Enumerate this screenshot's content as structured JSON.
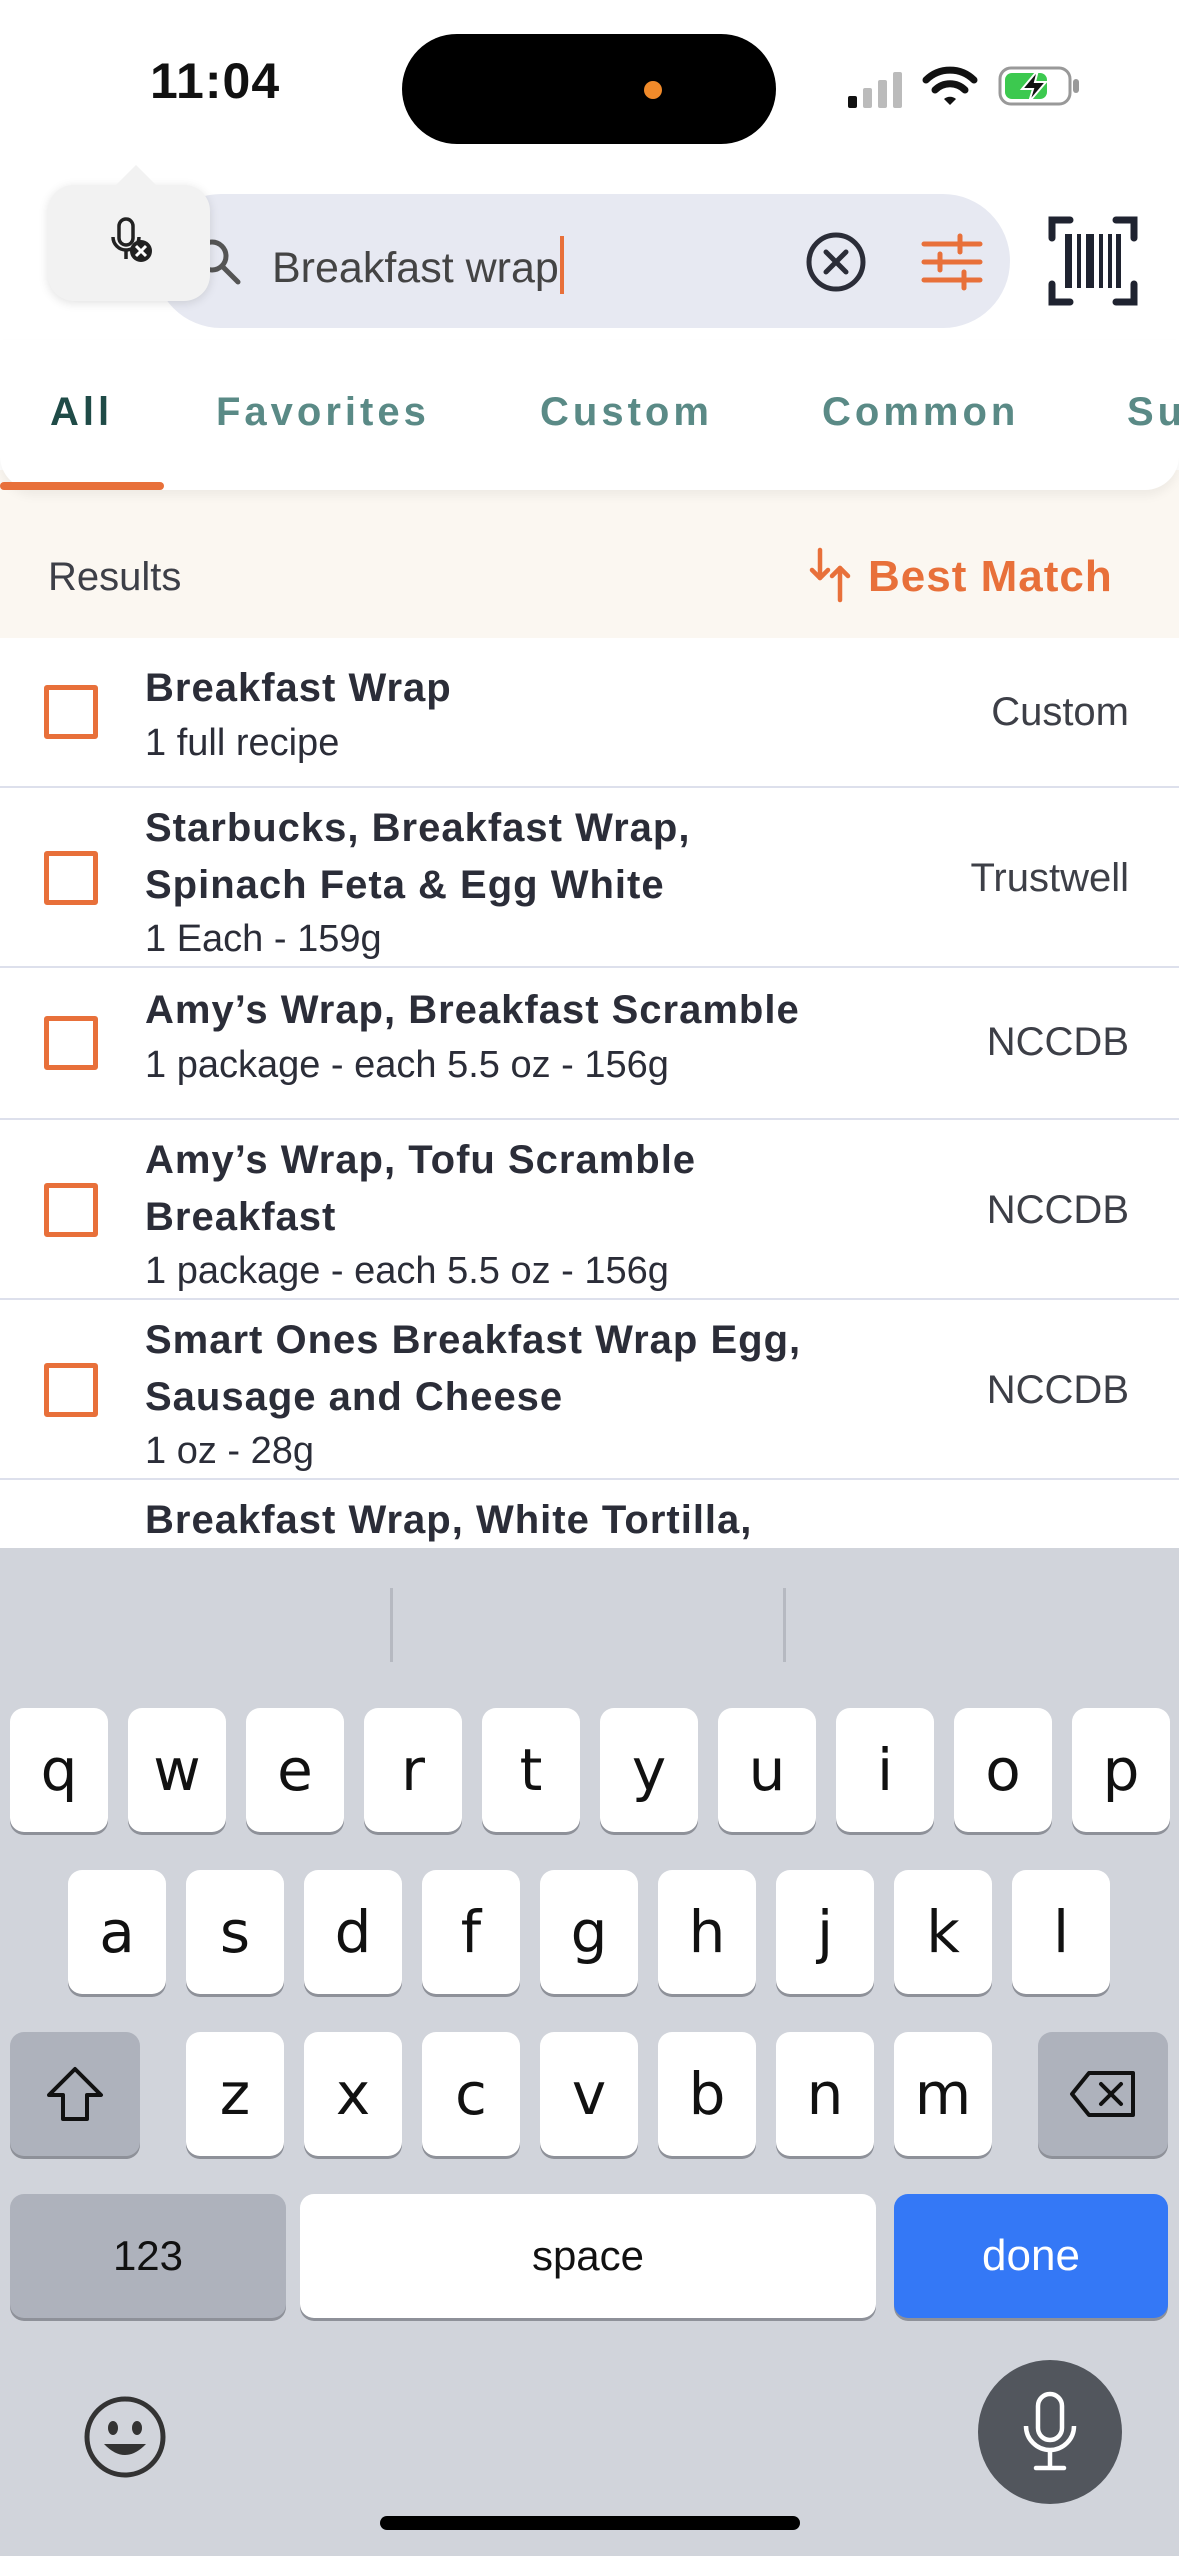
{
  "status_bar": {
    "time": "11:04"
  },
  "search": {
    "query": "Breakfast wrap"
  },
  "tabs": [
    {
      "label": "All",
      "active": true
    },
    {
      "label": "Favorites"
    },
    {
      "label": "Custom"
    },
    {
      "label": "Common"
    },
    {
      "label": "Su"
    }
  ],
  "results": {
    "label": "Results",
    "sort_label": "Best Match",
    "items": [
      {
        "name": [
          "Breakfast Wrap"
        ],
        "serving": "1 full recipe",
        "source": "Custom",
        "checked": false
      },
      {
        "name": [
          "Starbucks, Breakfast Wrap,",
          "Spinach Feta & Egg White"
        ],
        "serving": "1 Each - 159g",
        "source": "Trustwell",
        "checked": false
      },
      {
        "name": [
          "Amy’s Wrap, Breakfast Scramble"
        ],
        "serving": "1 package - each 5.5 oz - 156g",
        "source": "NCCDB",
        "checked": false
      },
      {
        "name": [
          "Amy’s Wrap, Tofu Scramble",
          "Breakfast"
        ],
        "serving": "1 package - each 5.5 oz - 156g",
        "source": "NCCDB",
        "checked": false
      },
      {
        "name": [
          "Smart Ones Breakfast Wrap Egg,",
          "Sausage and Cheese"
        ],
        "serving": "1 oz - 28g",
        "source": "NCCDB",
        "checked": false
      },
      {
        "name": [
          "Breakfast Wrap, White Tortilla,"
        ],
        "serving": "",
        "source": "",
        "checked": false
      }
    ]
  },
  "keyboard": {
    "row1": [
      "q",
      "w",
      "e",
      "r",
      "t",
      "y",
      "u",
      "i",
      "o",
      "p"
    ],
    "row2": [
      "a",
      "s",
      "d",
      "f",
      "g",
      "h",
      "j",
      "k",
      "l"
    ],
    "row3": [
      "z",
      "x",
      "c",
      "v",
      "b",
      "n",
      "m"
    ],
    "numbers_label": "123",
    "space_label": "space",
    "done_label": "done"
  },
  "colors": {
    "accent": "#e8703a",
    "tab_active": "#1f4b47",
    "tab_inactive": "#5a8a86",
    "done_key": "#3478f6"
  }
}
